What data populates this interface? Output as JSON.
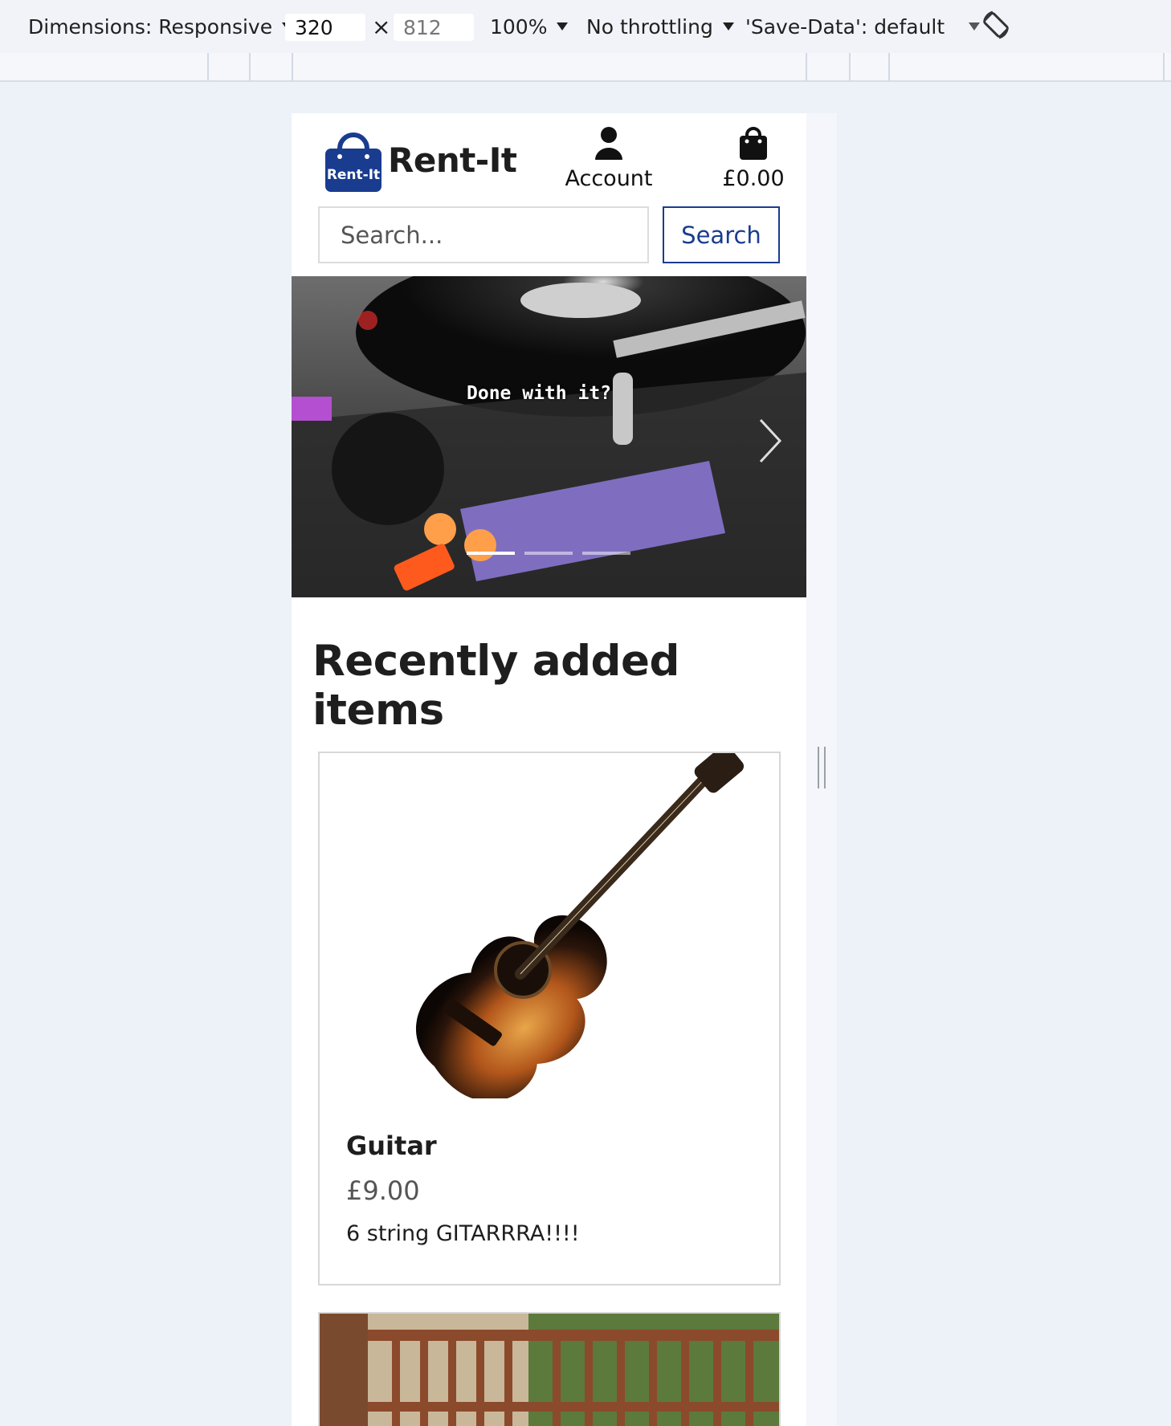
{
  "devtools": {
    "dimensions_label": "Dimensions: Responsive",
    "width_value": "320",
    "times": "×",
    "height_value": "812",
    "zoom": "100%",
    "throttling": "No throttling",
    "save_data": "'Save-Data': default",
    "rotate_icon": "rotate-icon"
  },
  "header": {
    "logo_text": "Rent-It",
    "brand": "Rent-It",
    "account_label": "Account",
    "cart_total": "£0.00",
    "search_placeholder": "Search...",
    "search_button": "Search"
  },
  "carousel": {
    "caption": "Done with it?",
    "indicators": 3,
    "active_index": 0
  },
  "main": {
    "section_title": "Recently added items",
    "items": [
      {
        "title": "Guitar",
        "price": "£9.00",
        "description": "6 string GITARRRA!!!!"
      }
    ]
  },
  "colors": {
    "brand_blue": "#1a3c8f",
    "page_bg": "#edf1f8"
  }
}
